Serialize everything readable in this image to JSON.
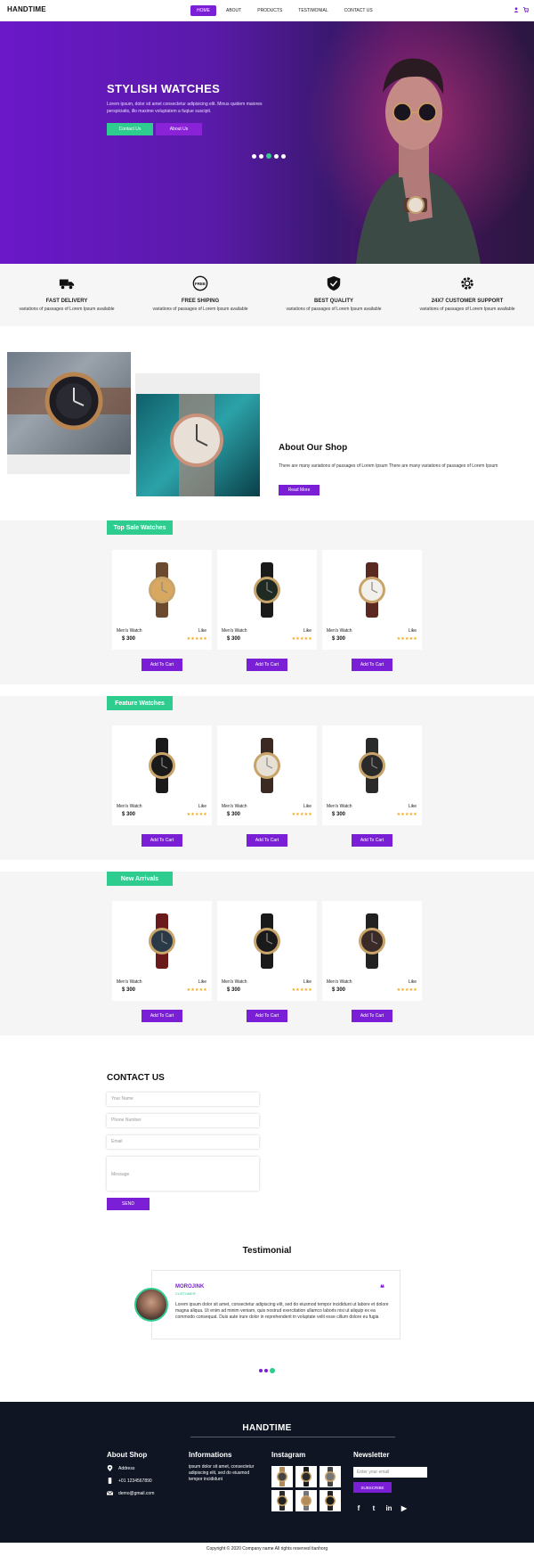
{
  "header": {
    "logo": "HANDTIME",
    "nav": [
      "HOME",
      "ABOUT",
      "PRODUCTS",
      "TESTIMONIAL",
      "CONTACT US"
    ],
    "active_nav": "HOME",
    "icons": [
      "user-icon",
      "cart-icon"
    ]
  },
  "hero": {
    "title": "STYLISH WATCHES",
    "subtitle": "Lorem ipsum, dolor sit amet consectetur adipisicing elit. Minus quidem maiores perspiciatis, illo maxime voluptatem a fuqiue suscipit.",
    "contact_button": "Contact Us",
    "about_button": "About Us",
    "slides": 5,
    "active_slide": 3
  },
  "features": [
    {
      "icon": "truck-icon",
      "title": "FAST DELIVERY",
      "desc": "variations of passages of Lorem Ipsum available"
    },
    {
      "icon": "free-icon",
      "title": "FREE SHIPING",
      "desc": "variations of passages of Lorem Ipsum available"
    },
    {
      "icon": "shield-check-icon",
      "title": "BEST QUALITY",
      "desc": "variations of passages of Lorem Ipsum available"
    },
    {
      "icon": "support-gear-icon",
      "title": "24X7 CUSTOMER SUPPORT",
      "desc": "variations of passages of Lorem Ipsum available"
    }
  ],
  "about": {
    "title": "About Our Shop",
    "text": "There are many variations of passages of Lorem Ipsum There are many variations of passages of Lorem Ipsum",
    "button": "Read More"
  },
  "sections": [
    {
      "title": "Top Sale Watches",
      "products": [
        {
          "name": "Men's Watch",
          "like": "Like",
          "price": "$ 300",
          "stars": "★★★★★",
          "button": "Add To Cart"
        },
        {
          "name": "Men's Watch",
          "like": "Like",
          "price": "$ 300",
          "stars": "★★★★★",
          "button": "Add To Cart"
        },
        {
          "name": "Men's Watch",
          "like": "Like",
          "price": "$ 300",
          "stars": "★★★★★",
          "button": "Add To Cart"
        }
      ]
    },
    {
      "title": "Feature Watches",
      "products": [
        {
          "name": "Men's Watch",
          "like": "Like",
          "price": "$ 300",
          "stars": "★★★★★",
          "button": "Add To Cart"
        },
        {
          "name": "Men's Watch",
          "like": "Like",
          "price": "$ 300",
          "stars": "★★★★★",
          "button": "Add To Cart"
        },
        {
          "name": "Men's Watch",
          "like": "Like",
          "price": "$ 300",
          "stars": "★★★★★",
          "button": "Add To Cart"
        }
      ]
    },
    {
      "title": "New Arrivals",
      "products": [
        {
          "name": "Men's Watch",
          "like": "Like",
          "price": "$ 300",
          "stars": "★★★★★",
          "button": "Add To Cart"
        },
        {
          "name": "Men's Watch",
          "like": "Like",
          "price": "$ 300",
          "stars": "★★★★★",
          "button": "Add To Cart"
        },
        {
          "name": "Men's Watch",
          "like": "Like",
          "price": "$ 300",
          "stars": "★★★★★",
          "button": "Add To Cart"
        }
      ]
    }
  ],
  "contact": {
    "title": "CONTACT US",
    "name_placeholder": "Your Name",
    "phone_placeholder": "Phone Number",
    "email_placeholder": "Email",
    "message_placeholder": "Message",
    "button": "SEND"
  },
  "testimonial": {
    "title": "Testimonial",
    "name": "MOROJINK",
    "role": "CUSTOMER",
    "quote_mark": "❝",
    "text": "Lorem ipsum dolor sit amet, consectetur adipiscing elit, sed do eiusmod tempor incididunt ut labore et dolore magna aliqua. Ut enim ad minim veniam, quis nostrud exercitation ullamco laboris nisi ut aliquip ex ea commodo consequat. Duis aute irure dolor in reprehenderit in voluptate velit esse cillum dolore eu fugia",
    "slides": 3,
    "active_slide": 3
  },
  "footer": {
    "logo": "HANDTIME",
    "about_title": "About Shop",
    "address": "Address",
    "phone": "+01 1234567890",
    "email": "demo@gmail.com",
    "info_title": "Informations",
    "info_text": "ipsum dolor sit amet, consectetur adipiscing elit, sed do eiusmod tempor incididunt",
    "instagram_title": "Instagram",
    "newsletter_title": "Newsletter",
    "newsletter_placeholder": "Enter your email",
    "subscribe": "SUBSCRIBE",
    "social": [
      "f",
      "t",
      "in",
      "▶"
    ],
    "copyright": "Copyright © 2020 Company name All rights reserved tianhorg"
  },
  "colors": {
    "primary": "#7b1fd6",
    "accent": "#2ecc8f",
    "star": "#f3a712",
    "footer_bg": "#0f1523"
  }
}
